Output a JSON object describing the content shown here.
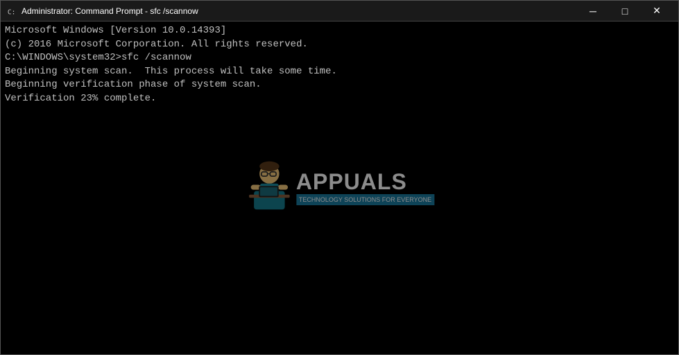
{
  "window": {
    "title": "Administrator: Command Prompt - sfc  /scannow",
    "icon": "cmd-icon"
  },
  "titlebar": {
    "minimize_label": "─",
    "maximize_label": "□",
    "close_label": "✕"
  },
  "terminal": {
    "lines": [
      "Microsoft Windows [Version 10.0.14393]",
      "(c) 2016 Microsoft Corporation. All rights reserved.",
      "",
      "C:\\WINDOWS\\system32>sfc /scannow",
      "",
      "Beginning system scan.  This process will take some time.",
      "",
      "Beginning verification phase of system scan.",
      "Verification 23% complete."
    ]
  },
  "watermark": {
    "brand": "APPUALS",
    "tagline": "TECHNOLOGY SOLUTIONS FOR EVERYONE"
  }
}
